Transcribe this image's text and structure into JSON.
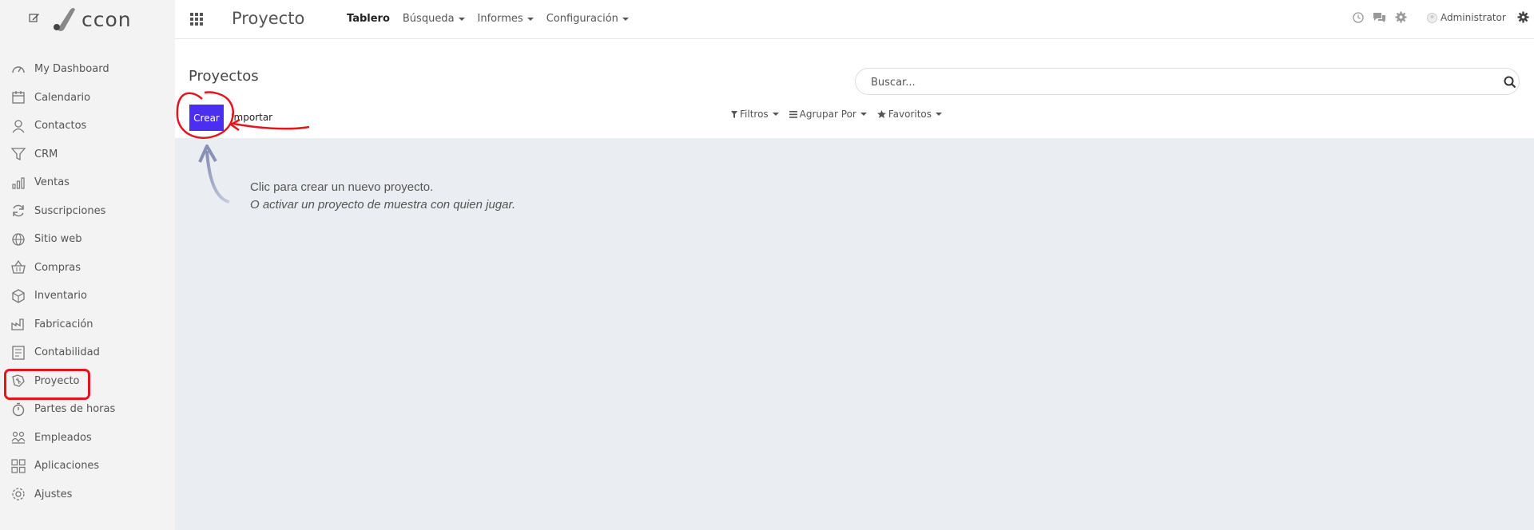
{
  "brand": {
    "logo_text": "ccon"
  },
  "sidebar": {
    "items": [
      {
        "label": "My Dashboard",
        "icon": "gauge-icon"
      },
      {
        "label": "Calendario",
        "icon": "calendar-icon"
      },
      {
        "label": "Contactos",
        "icon": "user-icon"
      },
      {
        "label": "CRM",
        "icon": "funnel-icon"
      },
      {
        "label": "Ventas",
        "icon": "bar-chart-icon"
      },
      {
        "label": "Suscripciones",
        "icon": "refresh-icon"
      },
      {
        "label": "Sitio web",
        "icon": "globe-icon"
      },
      {
        "label": "Compras",
        "icon": "basket-icon"
      },
      {
        "label": "Inventario",
        "icon": "box-icon"
      },
      {
        "label": "Fabricación",
        "icon": "factory-icon"
      },
      {
        "label": "Contabilidad",
        "icon": "ledger-icon"
      },
      {
        "label": "Proyecto",
        "icon": "puzzle-icon"
      },
      {
        "label": "Partes de horas",
        "icon": "stopwatch-icon"
      },
      {
        "label": "Empleados",
        "icon": "people-icon"
      },
      {
        "label": "Aplicaciones",
        "icon": "grid-icon"
      },
      {
        "label": "Ajustes",
        "icon": "gear-icon"
      }
    ]
  },
  "topbar": {
    "app_title": "Proyecto",
    "menu": [
      {
        "label": "Tablero"
      },
      {
        "label": "Búsqueda"
      },
      {
        "label": "Informes"
      },
      {
        "label": "Configuración"
      }
    ],
    "user": "Administrator"
  },
  "control": {
    "title": "Proyectos",
    "search_placeholder": "Buscar...",
    "create_label": "Crear",
    "import_label": "Importar",
    "filters_label": "Filtros",
    "group_label": "Agrupar Por",
    "favorites_label": "Favoritos"
  },
  "content": {
    "help_line1": "Clic para crear un nuevo proyecto.",
    "help_line2": "O activar un proyecto de muestra con quien jugar."
  },
  "colors": {
    "primary": "#4a2ff0",
    "annotation": "#e3161e",
    "content_bg": "#eaedf1",
    "sidebar_bg": "#f3f3f3"
  }
}
